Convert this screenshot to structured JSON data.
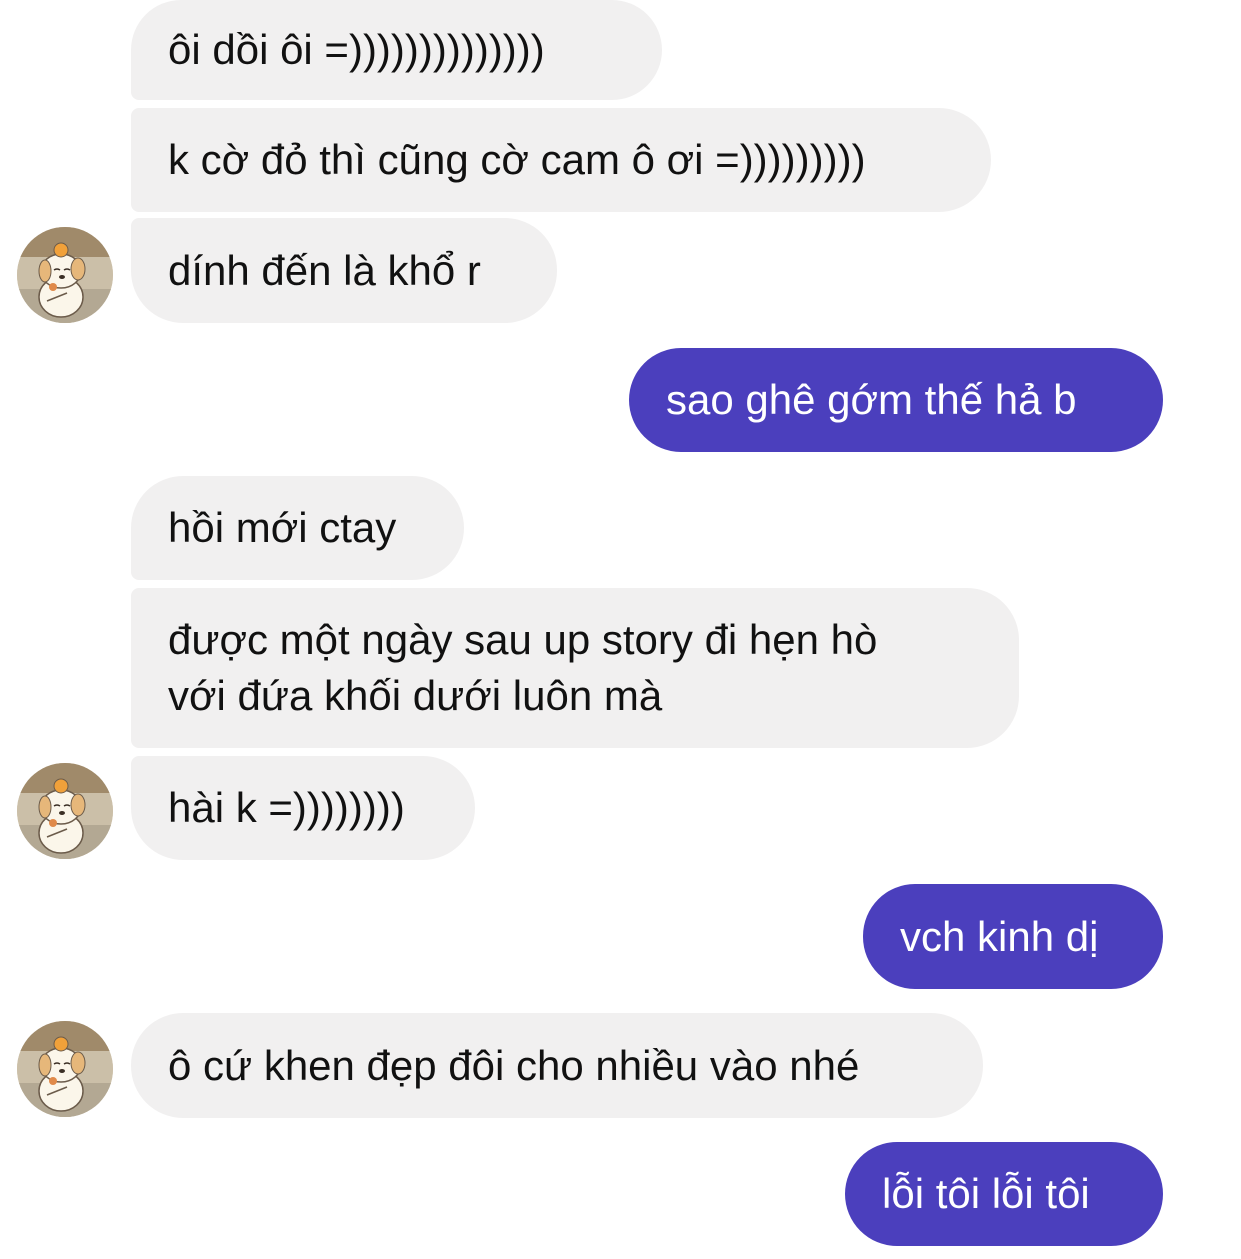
{
  "messages": [
    {
      "side": "in",
      "text": "ôi dồi ôi =))))))))))))))"
    },
    {
      "side": "in",
      "text": "k cờ đỏ thì cũng cờ cam ô ơi =)))))))))"
    },
    {
      "side": "in",
      "text": "dính đến là khổ r"
    },
    {
      "side": "out",
      "text": "sao ghê gớm thế hả b"
    },
    {
      "side": "in",
      "text": "hồi mới ctay"
    },
    {
      "side": "in",
      "lines": [
        "được một ngày sau up story đi hẹn hò",
        "với đứa khối dưới luôn mà"
      ]
    },
    {
      "side": "in",
      "text": "hài k =))))))))"
    },
    {
      "side": "out",
      "text": "vch kinh dị"
    },
    {
      "side": "in",
      "text": "ô cứ khen đẹp đôi cho nhiều vào nhé"
    },
    {
      "side": "out",
      "text": "lỗi tôi lỗi tôi"
    }
  ],
  "colors": {
    "incoming_bubble": "#f1f0f0",
    "outgoing_bubble": "#4b3fbd",
    "incoming_text": "#111111",
    "outgoing_text": "#ffffff"
  },
  "avatar": {
    "icon": "puppy-avatar-icon"
  }
}
